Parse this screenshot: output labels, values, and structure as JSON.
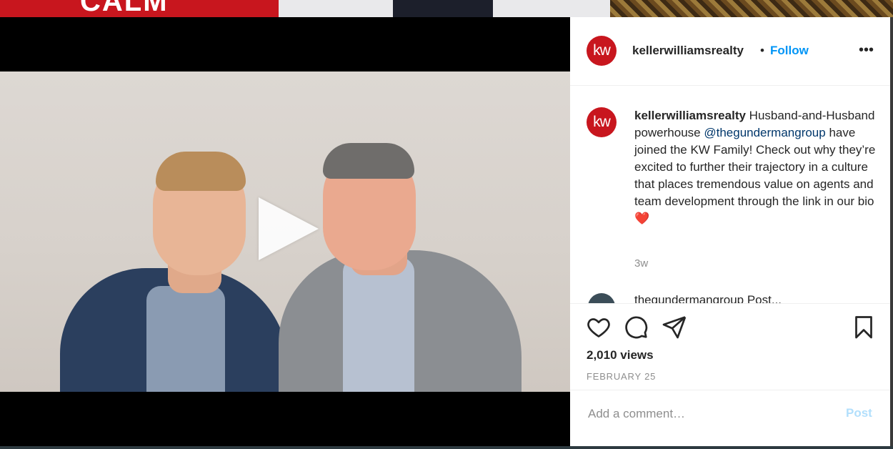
{
  "background": {
    "tile_text": "CALM"
  },
  "post": {
    "username": "kellerwilliamsrealty",
    "avatar_text": "kw",
    "separator": "•",
    "follow_label": "Follow",
    "more_icon": "more-horizontal-icon",
    "caption_username": "kellerwilliamsrealty",
    "caption_part1": " Husband-and-Husband powerhouse ",
    "mention": "@thegundermangroup",
    "caption_part2": " have joined the KW Family! Check out why they’re excited to further their trajectory in a culture that places tremendous value on agents and team development through the link in our bio ❤️",
    "time_ago": "3w",
    "next_comment_partial": "thegundermangroup Post...",
    "views": "2,010 views",
    "date": "FEBRUARY 25"
  },
  "icons": {
    "like": "heart-icon",
    "comment": "comment-icon",
    "share": "paper-plane-icon",
    "save": "bookmark-icon",
    "play": "play-icon"
  },
  "comment_box": {
    "placeholder": "Add a comment…",
    "post_label": "Post"
  },
  "colors": {
    "brand_red": "#c8161e",
    "follow_blue": "#0095f6",
    "post_disabled": "#b2dffc",
    "mention_blue": "#00376b"
  }
}
